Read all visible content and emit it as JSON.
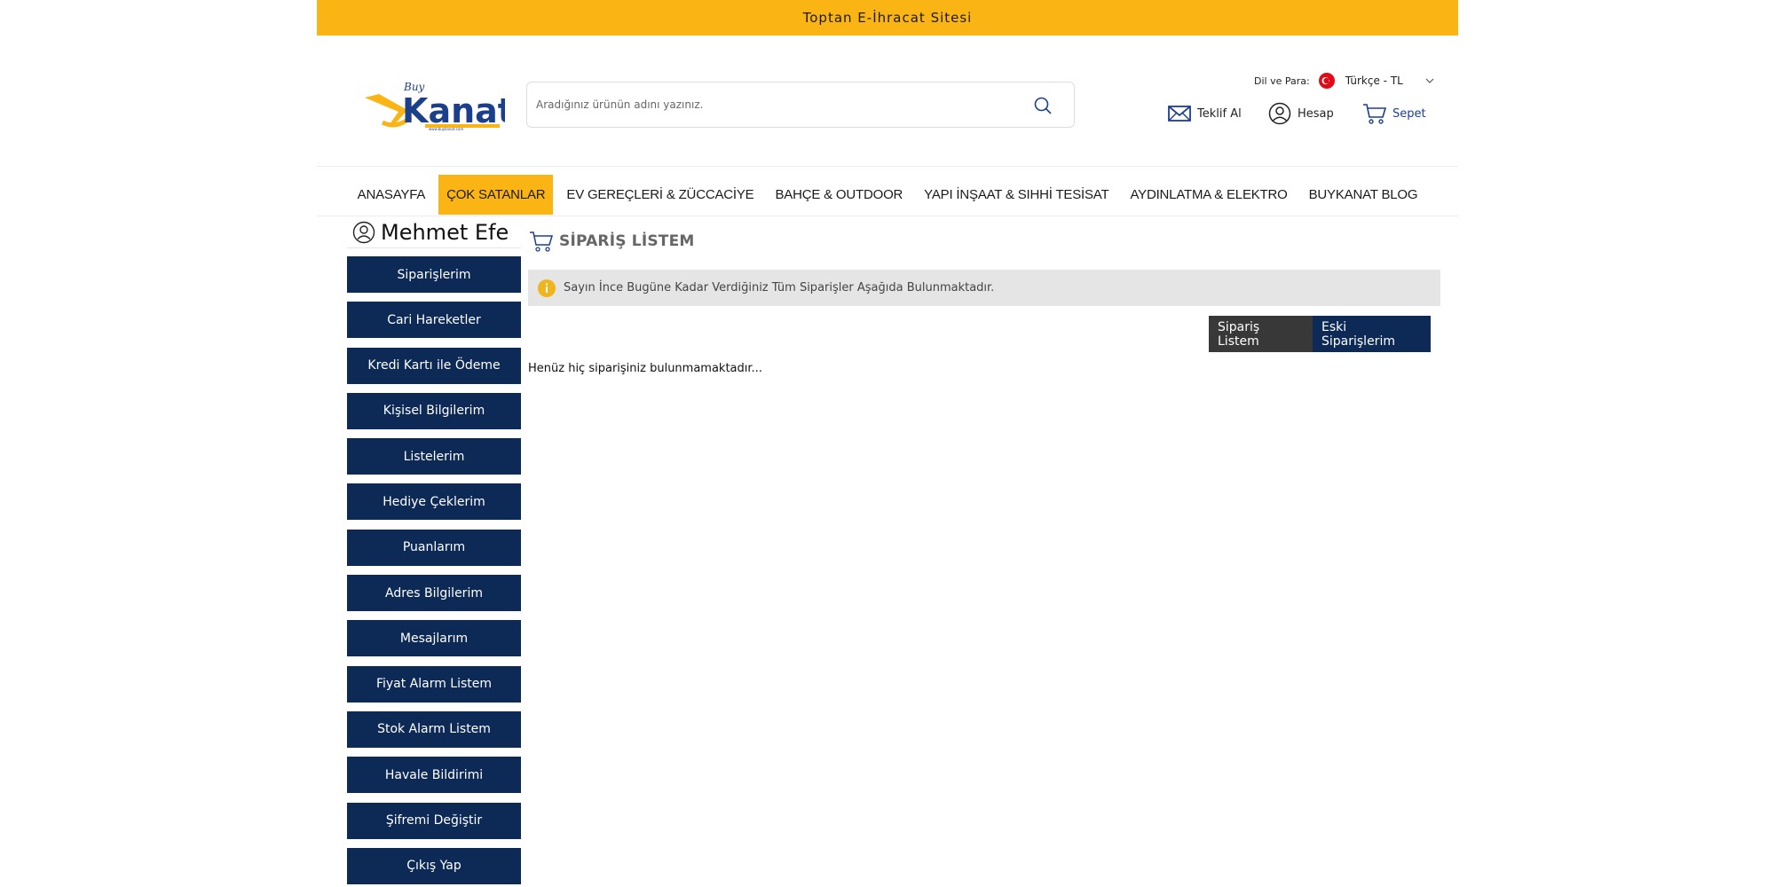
{
  "topbar": {
    "text": "Toptan E-İhracat Sitesi"
  },
  "header": {
    "logo": {
      "small": "Buy",
      "brand": "Kanat",
      "url_text": "www.buykanat.com"
    },
    "search": {
      "placeholder": "Aradığınız ürünün adını yazınız."
    },
    "language": {
      "label": "Dil ve Para:",
      "value": "Türkçe - TL"
    },
    "actions": {
      "offer": "Teklif Al",
      "account": "Hesap",
      "cart": "Sepet"
    }
  },
  "nav": [
    "ANASAYFA",
    "ÇOK SATANLAR",
    "EV GEREÇLERİ & ZÜCCACİYE",
    "BAHÇE & OUTDOOR",
    "YAPI İNŞAAT & SIHHİ TESİSAT",
    "AYDINLATMA & ELEKTRO",
    "BUYKANAT BLOG"
  ],
  "sidebar": {
    "user_name": "Mehmet Efe",
    "items": [
      "Siparişlerim",
      "Cari Hareketler",
      "Kredi Kartı ile Ödeme",
      "Kişisel Bilgilerim",
      "Listelerim",
      "Hediye Çeklerim",
      "Puanlarım",
      "Adres Bilgilerim",
      "Mesajlarım",
      "Fiyat Alarm Listem",
      "Stok Alarm Listem",
      "Havale Bildirimi",
      "Şifremi Değiştir",
      "Çıkış Yap"
    ]
  },
  "content": {
    "title": "SİPARİŞ LİSTEM",
    "info": "Sayın İnce Bugüne Kadar Verdiğiniz Tüm Siparişler Aşağıda Bulunmaktadır.",
    "tabs": [
      "Sipariş Listem",
      "Eski Siparişlerim"
    ],
    "empty_message": "Henüz hiç siparişiniz bulunmamaktadır..."
  },
  "colors": {
    "accent": "#fab514",
    "navy": "#0d2a57",
    "dark_tab": "#383838",
    "info_bg": "#e5e5e5"
  }
}
